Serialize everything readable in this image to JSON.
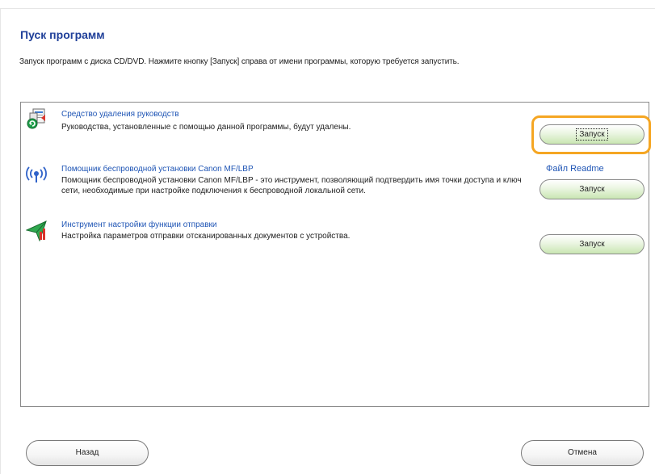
{
  "page": {
    "title": "Пуск программ",
    "instruction": "Запуск программ с диска CD/DVD. Нажмите кнопку [Запуск] справа от имени программы, которую требуется запустить."
  },
  "apps": [
    {
      "name": "Средство удаления руководств",
      "description": "Руководства, установленные с помощью данной программы, будут удалены.",
      "button": "Запуск",
      "icon": "uninstall-manuals-icon"
    },
    {
      "name": "Помощник беспроводной установки Canon MF/LBP",
      "description": "Помощник беспроводной установки Canon MF/LBP - это инструмент, позволяющий подтвердить имя точки доступа и ключ сети, необходимые при настройке подключения к беспроводной локальной сети.",
      "button": "Запуск",
      "readme": "Файл Readme",
      "icon": "wireless-icon"
    },
    {
      "name": "Инструмент настройки функции отправки",
      "description": "Настройка параметров отправки отсканированных документов с устройства.",
      "button": "Запуск",
      "icon": "send-settings-icon"
    }
  ],
  "footer": {
    "back": "Назад",
    "cancel": "Отмена"
  },
  "colors": {
    "title": "#1f3f99",
    "link": "#1f55b5",
    "focus": "#f5a623"
  }
}
